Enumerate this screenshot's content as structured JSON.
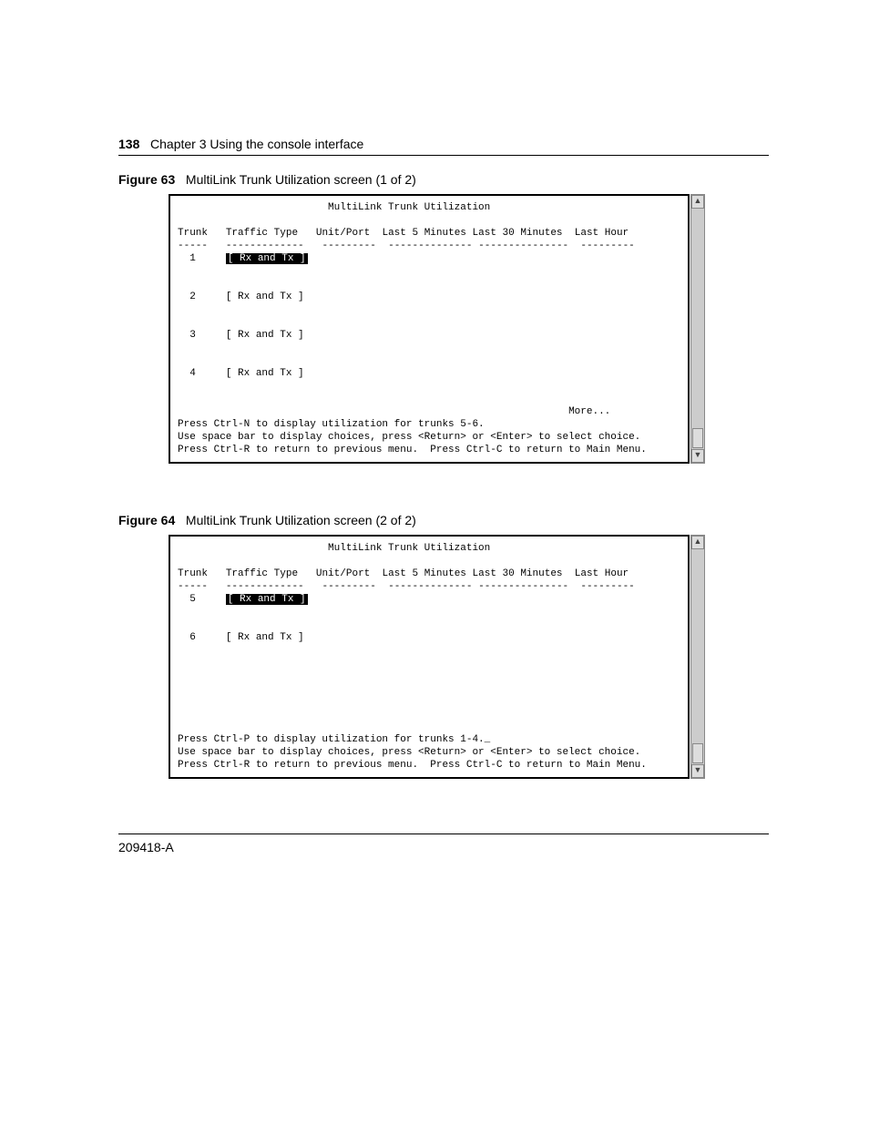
{
  "header": {
    "page_number": "138",
    "chapter": "Chapter 3  Using the console interface"
  },
  "figure1": {
    "label": "Figure 63",
    "caption": "MultiLink Trunk Utilization screen (1 of 2)",
    "screen": {
      "title": "MultiLink Trunk Utilization",
      "cols": {
        "c1": "Trunk",
        "c2": "Traffic Type",
        "c3": "Unit/Port",
        "c4": "Last 5 Minutes",
        "c5": "Last 30 Minutes",
        "c6": "Last Hour"
      },
      "sep": {
        "c1": "-----",
        "c2": "-------------",
        "c3": "---------",
        "c4": "--------------",
        "c5": "---------------",
        "c6": "---------"
      },
      "rows": [
        {
          "trunk": "1",
          "traffic": "[ Rx and Tx ]",
          "selected": true
        },
        {
          "trunk": "2",
          "traffic": "[ Rx and Tx ]",
          "selected": false
        },
        {
          "trunk": "3",
          "traffic": "[ Rx and Tx ]",
          "selected": false
        },
        {
          "trunk": "4",
          "traffic": "[ Rx and Tx ]",
          "selected": false
        }
      ],
      "more": "More...",
      "help1": "Press Ctrl-N to display utilization for trunks 5-6.",
      "help2": "Use space bar to display choices, press <Return> or <Enter> to select choice.",
      "help3": "Press Ctrl-R to return to previous menu.  Press Ctrl-C to return to Main Menu."
    }
  },
  "figure2": {
    "label": "Figure 64",
    "caption": "MultiLink Trunk Utilization screen (2 of 2)",
    "screen": {
      "title": "MultiLink Trunk Utilization",
      "cols": {
        "c1": "Trunk",
        "c2": "Traffic Type",
        "c3": "Unit/Port",
        "c4": "Last 5 Minutes",
        "c5": "Last 30 Minutes",
        "c6": "Last Hour"
      },
      "sep": {
        "c1": "-----",
        "c2": "-------------",
        "c3": "---------",
        "c4": "--------------",
        "c5": "---------------",
        "c6": "---------"
      },
      "rows": [
        {
          "trunk": "5",
          "traffic": "[ Rx and Tx ]",
          "selected": true
        },
        {
          "trunk": "6",
          "traffic": "[ Rx and Tx ]",
          "selected": false
        }
      ],
      "help1": "Press Ctrl-P to display utilization for trunks 1-4._",
      "help2": "Use space bar to display choices, press <Return> or <Enter> to select choice.",
      "help3": "Press Ctrl-R to return to previous menu.  Press Ctrl-C to return to Main Menu."
    }
  },
  "footer": {
    "docnum": "209418-A"
  }
}
